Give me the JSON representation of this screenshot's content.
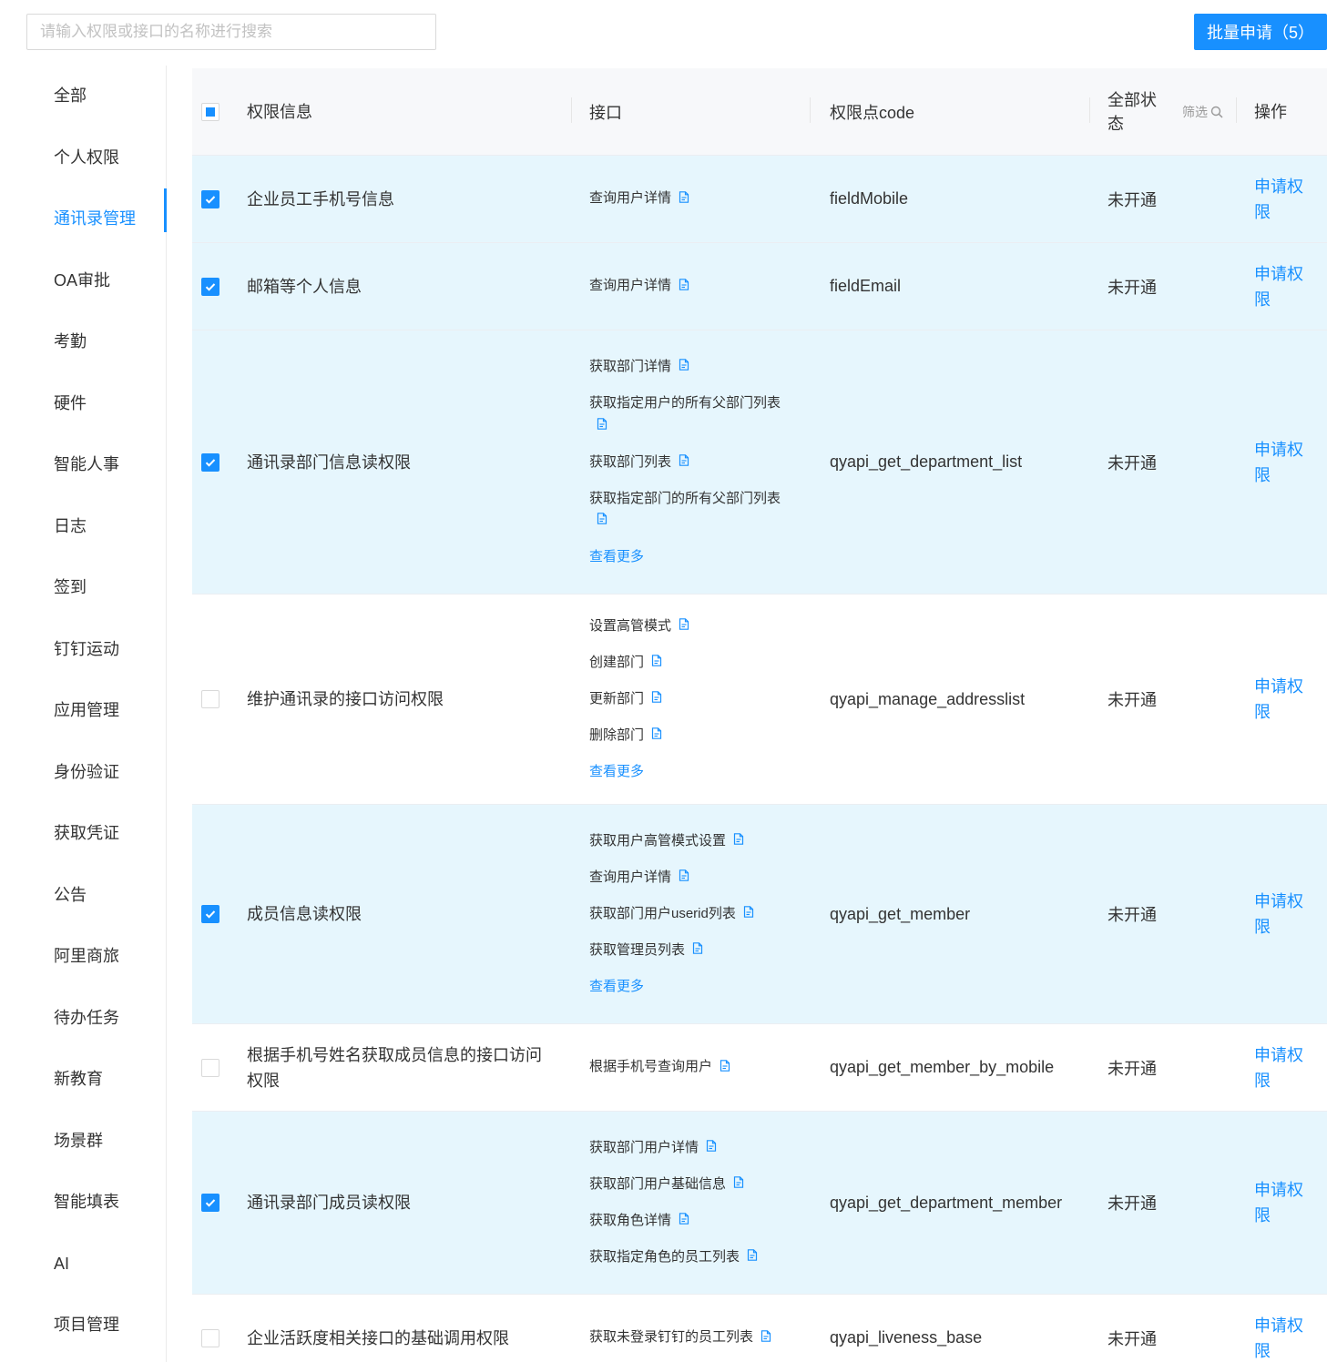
{
  "search": {
    "placeholder": "请输入权限或接口的名称进行搜索"
  },
  "batch_button": {
    "label": "批量申请（5）"
  },
  "sidebar": {
    "active_index": 2,
    "items": [
      {
        "label": "全部"
      },
      {
        "label": "个人权限"
      },
      {
        "label": "通讯录管理"
      },
      {
        "label": "OA审批"
      },
      {
        "label": "考勤"
      },
      {
        "label": "硬件"
      },
      {
        "label": "智能人事"
      },
      {
        "label": "日志"
      },
      {
        "label": "签到"
      },
      {
        "label": "钉钉运动"
      },
      {
        "label": "应用管理"
      },
      {
        "label": "身份验证"
      },
      {
        "label": "获取凭证"
      },
      {
        "label": "公告"
      },
      {
        "label": "阿里商旅"
      },
      {
        "label": "待办任务"
      },
      {
        "label": "新教育"
      },
      {
        "label": "场景群"
      },
      {
        "label": "智能填表"
      },
      {
        "label": "AI"
      },
      {
        "label": "项目管理"
      }
    ]
  },
  "table": {
    "headers": {
      "info": "权限信息",
      "api": "接口",
      "code": "权限点code",
      "status": "全部状态",
      "filter": "筛选",
      "op": "操作"
    },
    "rows": [
      {
        "checked": true,
        "info": "企业员工手机号信息",
        "apis": [
          "查询用户详情"
        ],
        "more": "",
        "code": "fieldMobile",
        "status": "未开通",
        "op": "申请权限"
      },
      {
        "checked": true,
        "info": "邮箱等个人信息",
        "apis": [
          "查询用户详情"
        ],
        "more": "",
        "code": "fieldEmail",
        "status": "未开通",
        "op": "申请权限"
      },
      {
        "checked": true,
        "info": "通讯录部门信息读权限",
        "apis": [
          "获取部门详情",
          "获取指定用户的所有父部门列表",
          "获取部门列表",
          "获取指定部门的所有父部门列表"
        ],
        "more": "查看更多",
        "code": "qyapi_get_department_list",
        "status": "未开通",
        "op": "申请权限"
      },
      {
        "checked": false,
        "info": "维护通讯录的接口访问权限",
        "apis": [
          "设置高管模式",
          "创建部门",
          "更新部门",
          "删除部门"
        ],
        "more": "查看更多",
        "code": "qyapi_manage_addresslist",
        "status": "未开通",
        "op": "申请权限"
      },
      {
        "checked": true,
        "info": "成员信息读权限",
        "apis": [
          "获取用户高管模式设置",
          "查询用户详情",
          "获取部门用户userid列表",
          "获取管理员列表"
        ],
        "more": "查看更多",
        "code": "qyapi_get_member",
        "status": "未开通",
        "op": "申请权限"
      },
      {
        "checked": false,
        "info": "根据手机号姓名获取成员信息的接口访问权限",
        "apis": [
          "根据手机号查询用户"
        ],
        "more": "",
        "code": "qyapi_get_member_by_mobile",
        "status": "未开通",
        "op": "申请权限"
      },
      {
        "checked": true,
        "info": "通讯录部门成员读权限",
        "apis": [
          "获取部门用户详情",
          "获取部门用户基础信息",
          "获取角色详情",
          "获取指定角色的员工列表"
        ],
        "more": "",
        "code": "qyapi_get_department_member",
        "status": "未开通",
        "op": "申请权限"
      },
      {
        "checked": false,
        "info": "企业活跃度相关接口的基础调用权限",
        "apis": [
          "获取未登录钉钉的员工列表"
        ],
        "more": "",
        "code": "qyapi_liveness_base",
        "status": "未开通",
        "op": "申请权限"
      }
    ]
  },
  "colors": {
    "accent": "#1890ff",
    "selected_row": "#e6f6fd",
    "header_bg": "#f7f8fa"
  },
  "icons": {
    "doc": "doc-icon",
    "search": "search-icon",
    "check": "check-icon"
  }
}
